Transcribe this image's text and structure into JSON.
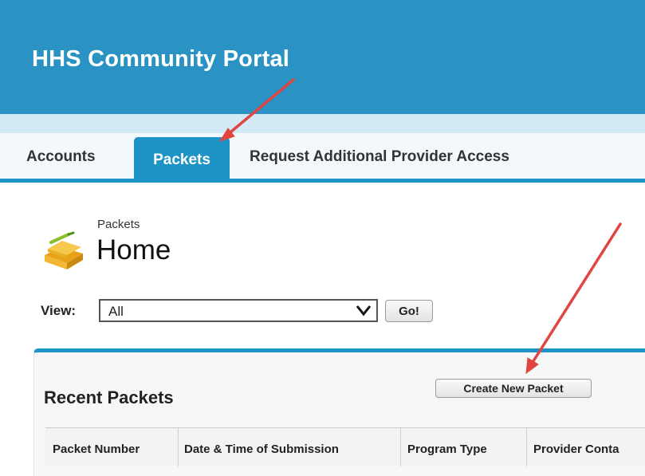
{
  "portal": {
    "title": "HHS Community Portal"
  },
  "tabs": [
    {
      "label": "Accounts",
      "active": false
    },
    {
      "label": "Packets",
      "active": true
    },
    {
      "label": "Request Additional Provider Access",
      "active": false
    }
  ],
  "page": {
    "breadcrumb": "Packets",
    "title": "Home",
    "icon": "packets-icon"
  },
  "view": {
    "label": "View:",
    "selected": "All",
    "go_label": "Go!"
  },
  "recent": {
    "title": "Recent Packets",
    "create_label": "Create New Packet",
    "columns": [
      "Packet Number",
      "Date & Time of Submission",
      "Program Type",
      "Provider Conta"
    ]
  },
  "colors": {
    "header": "#2a93c4",
    "accent": "#1e93c6",
    "annotation_arrow": "#e0463f"
  }
}
